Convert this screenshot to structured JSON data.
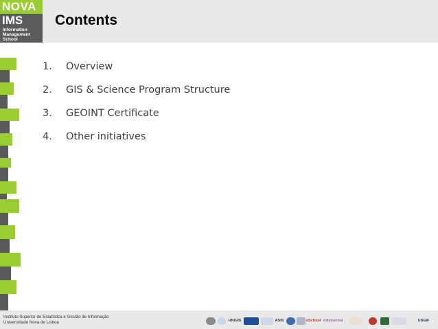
{
  "header": {
    "logo": {
      "line1": "NOVA",
      "line2": "IMS",
      "school": [
        "Information",
        "Management",
        "School"
      ]
    },
    "title": "Contents"
  },
  "contents": {
    "items": [
      {
        "number": "1.",
        "label": "Overview"
      },
      {
        "number": "2.",
        "label": "GIS & Science Program Structure"
      },
      {
        "number": "3.",
        "label": "GEOINT Certificate"
      },
      {
        "number": "4.",
        "label": "Other initiatives"
      }
    ]
  },
  "footer": {
    "institute": "Instituto Superior de Estatística e Gestão de Informação",
    "university": "Universidade Nova de Lisboa",
    "partners": [
      "UNIGIS",
      "ASIS",
      "eSchools",
      "eduniversal",
      "USGIF"
    ]
  },
  "colors": {
    "accent_green": "#9acd32",
    "dark_gray": "#595959",
    "band_gray": "#e9e9e9"
  }
}
